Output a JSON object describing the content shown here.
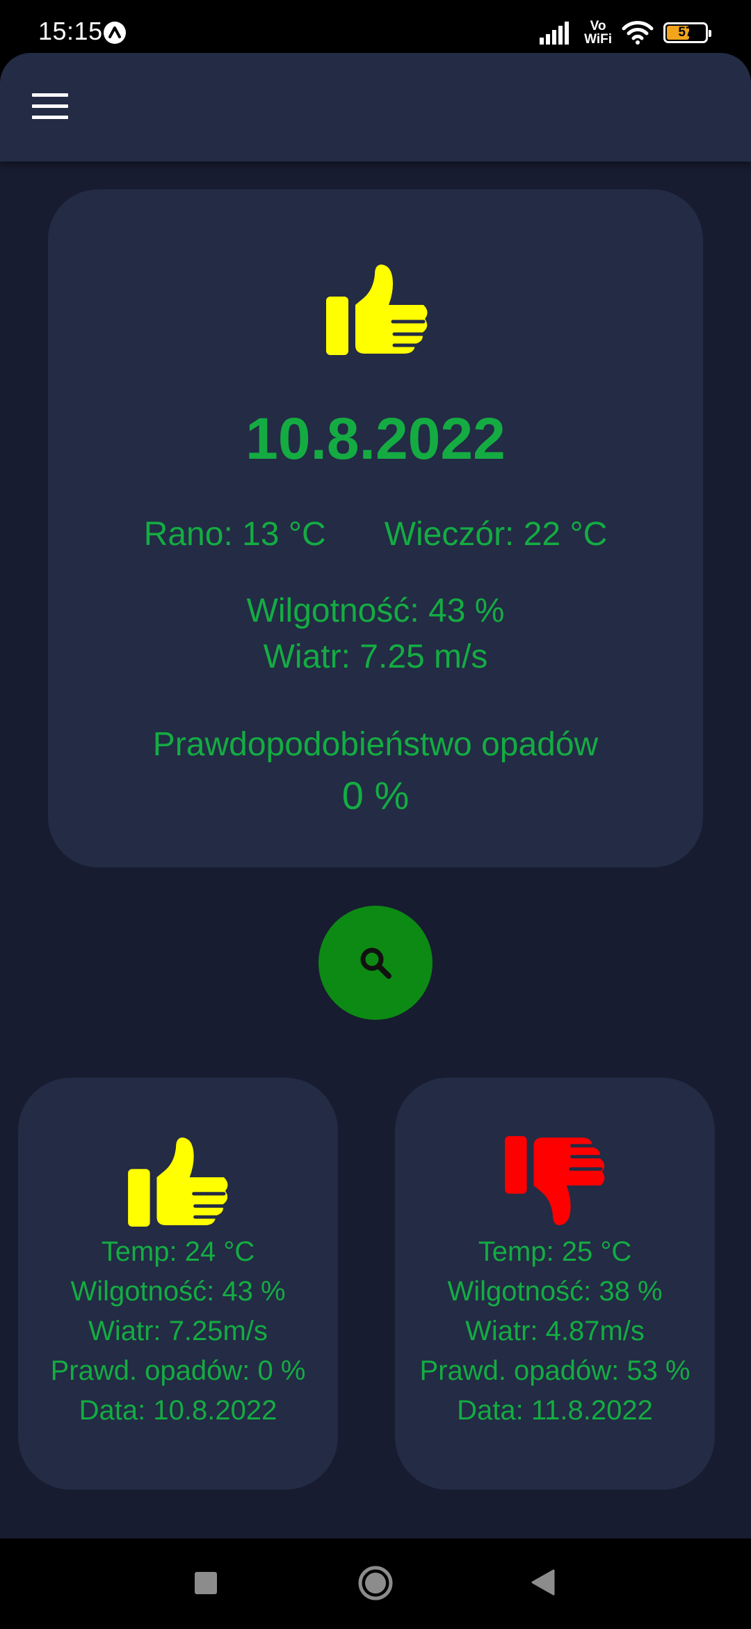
{
  "status_bar": {
    "time": "15:15",
    "network_label_top": "Vo",
    "network_label_bottom": "WiFi",
    "battery_level": "57"
  },
  "header": {
    "menu_icon": "hamburger-menu-icon"
  },
  "main_card": {
    "icon": "thumbs-up-icon",
    "icon_color": "#ffff00",
    "date": "10.8.2022",
    "morning": "Rano: 13 °C",
    "evening": "Wieczór: 22 °C",
    "humidity": "Wilgotność: 43 %",
    "wind": "Wiatr: 7.25 m/s",
    "precip_label": "Prawdopodobieństwo opadów",
    "precip_value": "0 %"
  },
  "search_button": {
    "icon": "search-icon",
    "color": "#0d8a14"
  },
  "cards": [
    {
      "icon": "thumbs-up-icon",
      "icon_color": "#ffff00",
      "temp": "Temp: 24 °C",
      "humidity": "Wilgotność: 43 %",
      "wind": "Wiatr: 7.25m/s",
      "precip": "Prawd. opadów: 0 %",
      "date": "Data: 10.8.2022"
    },
    {
      "icon": "thumbs-down-icon",
      "icon_color": "#ff0000",
      "temp": "Temp: 25 °C",
      "humidity": "Wilgotność: 38 %",
      "wind": "Wiatr: 4.87m/s",
      "precip": "Prawd. opadów: 53 %",
      "date": "Data: 11.8.2022"
    }
  ],
  "colors": {
    "text_accent": "#14ac42",
    "background": "#171c30",
    "card": "#232b45"
  },
  "nav_bar": {
    "recents_icon": "square-recents-icon",
    "home_icon": "circle-home-icon",
    "back_icon": "triangle-back-icon"
  }
}
